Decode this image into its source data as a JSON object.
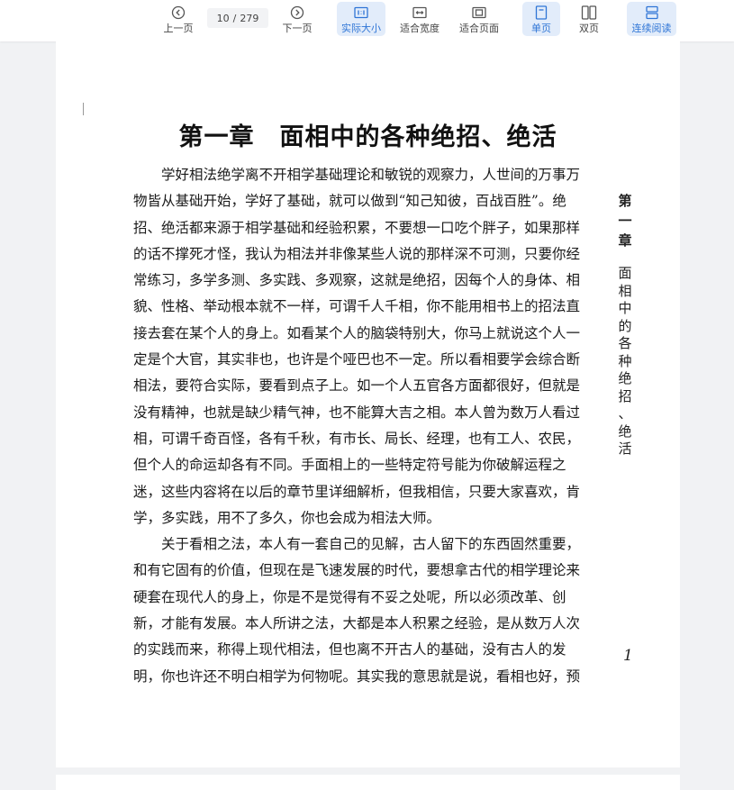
{
  "toolbar": {
    "prev_label": "上一页",
    "next_label": "下一页",
    "current_page": "10",
    "separator": "/",
    "total_pages": "279",
    "actual_size_label": "实际大小",
    "fit_width_label": "适合宽度",
    "fit_page_label": "适合页面",
    "single_page_label": "单页",
    "double_page_label": "双页",
    "continuous_label": "连续阅读",
    "active_color": "#2f75d6",
    "active_bg": "#e2ecfa"
  },
  "page": {
    "chapter_title_part1": "第一章",
    "chapter_title_part2": "面相中的各种绝招、绝活",
    "side_label_bold": [
      "第",
      "一",
      "章"
    ],
    "side_label_chars": [
      "面",
      "相",
      "中",
      "的",
      "各",
      "种",
      "绝",
      "招",
      "、",
      "绝",
      "活"
    ],
    "page_number": "1",
    "paragraph1_lines": [
      "学好相法绝学离不开相学基础理论和敏锐的观察力，人世间的万事万",
      "物皆从基础开始，学好了基础，就可以做到“知己知彼，百战百胜”。绝",
      "招、绝活都来源于相学基础和经验积累，不要想一口吃个胖子，如果那样",
      "的话不撑死才怪，我认为相法并非像某些人说的那样深不可测，只要你经",
      "常练习，多学多测、多实践、多观察，这就是绝招，因每个人的身体、相",
      "貌、性格、举动根本就不一样，可谓千人千相，你不能用相书上的招法直",
      "接去套在某个人的身上。如看某个人的脑袋特别大，你马上就说这个人一",
      "定是个大官，其实非也，也许是个哑巴也不一定。所以看相要学会综合断",
      "相法，要符合实际，要看到点子上。如一个人五官各方面都很好，但就是",
      "没有精神，也就是缺少精气神，也不能算大吉之相。本人曾为数万人看过",
      "相，可谓千奇百怪，各有千秋，有市长、局长、经理，也有工人、农民，",
      "但个人的命运却各有不同。手面相上的一些特定符号能为你破解运程之",
      "迷，这些内容将在以后的章节里详细解析，但我相信，只要大家喜欢，肯",
      "学，多实践，用不了多久，你也会成为相法大师。"
    ],
    "paragraph2_lines": [
      "关于看相之法，本人有一套自己的见解，古人留下的东西固然重要，",
      "和有它固有的价值，但现在是飞速发展的时代，要想拿古代的相学理论来",
      "硬套在现代人的身上，你是不是觉得有不妥之处呢，所以必须改革、创",
      "新，才能有发展。本人所讲之法，大都是本人积累之经验，是从数万人次",
      "的实践而来，称得上现代相法，但也离不开古人的基础，没有古人的发",
      "明，你也许还不明白相学为何物呢。其实我的意思就是说，看相也好，预"
    ]
  }
}
